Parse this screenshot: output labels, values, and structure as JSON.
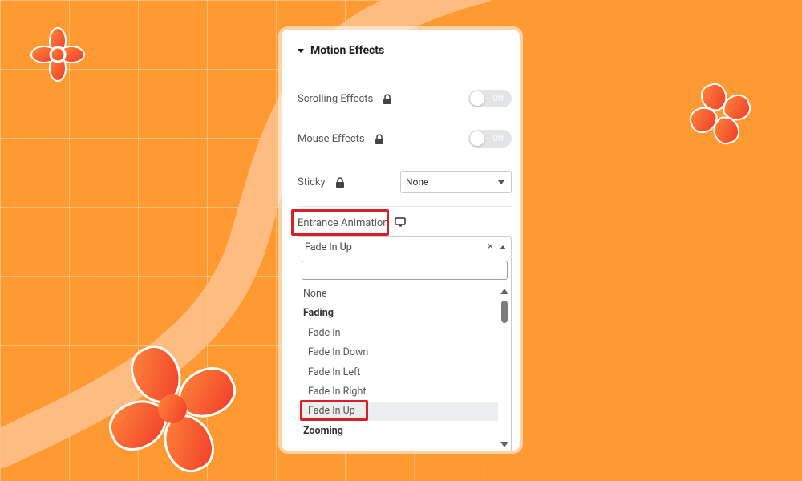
{
  "panel": {
    "section_title": "Motion Effects",
    "scrolling_effects": {
      "label": "Scrolling Effects",
      "toggle": "Off"
    },
    "mouse_effects": {
      "label": "Mouse Effects",
      "toggle": "Off"
    },
    "sticky": {
      "label": "Sticky",
      "value": "None"
    },
    "entrance_animation": {
      "label": "Entrance Animation",
      "selected": "Fade In Up",
      "clear_symbol": "×",
      "search_value": "",
      "options": [
        {
          "label": "None",
          "kind": "option"
        },
        {
          "label": "Fading",
          "kind": "group"
        },
        {
          "label": "Fade In",
          "kind": "child"
        },
        {
          "label": "Fade In Down",
          "kind": "child"
        },
        {
          "label": "Fade In Left",
          "kind": "child"
        },
        {
          "label": "Fade In Right",
          "kind": "child"
        },
        {
          "label": "Fade In Up",
          "kind": "child"
        },
        {
          "label": "Zooming",
          "kind": "group"
        }
      ]
    }
  },
  "icons": {
    "lock": "lock-icon",
    "monitor": "desktop-icon",
    "caret": "caret-down-icon"
  },
  "colors": {
    "background": "#FF9A33",
    "highlight_border": "#D91F26",
    "panel": "#FFFFFF"
  }
}
